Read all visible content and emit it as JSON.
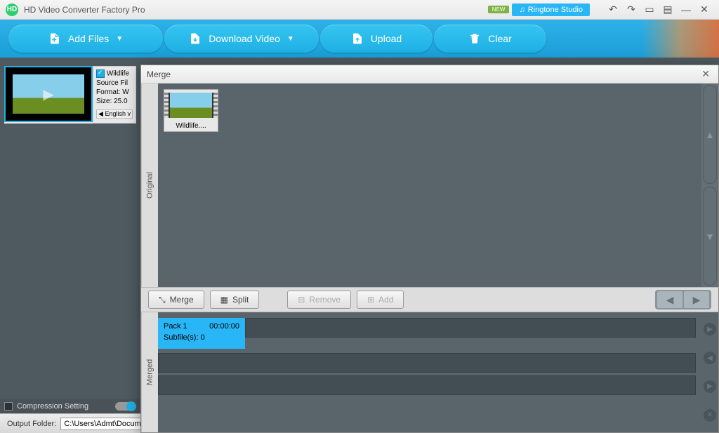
{
  "titlebar": {
    "app_title": "HD Video Converter Factory Pro",
    "new_badge": "NEW",
    "ringtone_label": "Ringtone Studio"
  },
  "toolbar": {
    "add_files": "Add Files",
    "download_video": "Download Video",
    "upload": "Upload",
    "clear": "Clear"
  },
  "file_item": {
    "name": "Wildlife",
    "source_file": "Source Fil",
    "format": "Format: W",
    "size": "Size: 25.0",
    "lang": "English v"
  },
  "compression": {
    "label": "Compression Setting"
  },
  "output": {
    "label": "Output Folder:",
    "path": "C:\\Users\\Admt\\Docum"
  },
  "dialog": {
    "title": "Merge",
    "original_label": "Original",
    "merged_label": "Merged",
    "orig_item_name": "Wildlife....",
    "btn_merge": "Merge",
    "btn_split": "Split",
    "btn_remove": "Remove",
    "btn_add": "Add",
    "pack": {
      "name": "Pack 1",
      "time": "00:00:00",
      "subfiles_label": "Subfile(s):",
      "subfiles_count": "0"
    }
  }
}
